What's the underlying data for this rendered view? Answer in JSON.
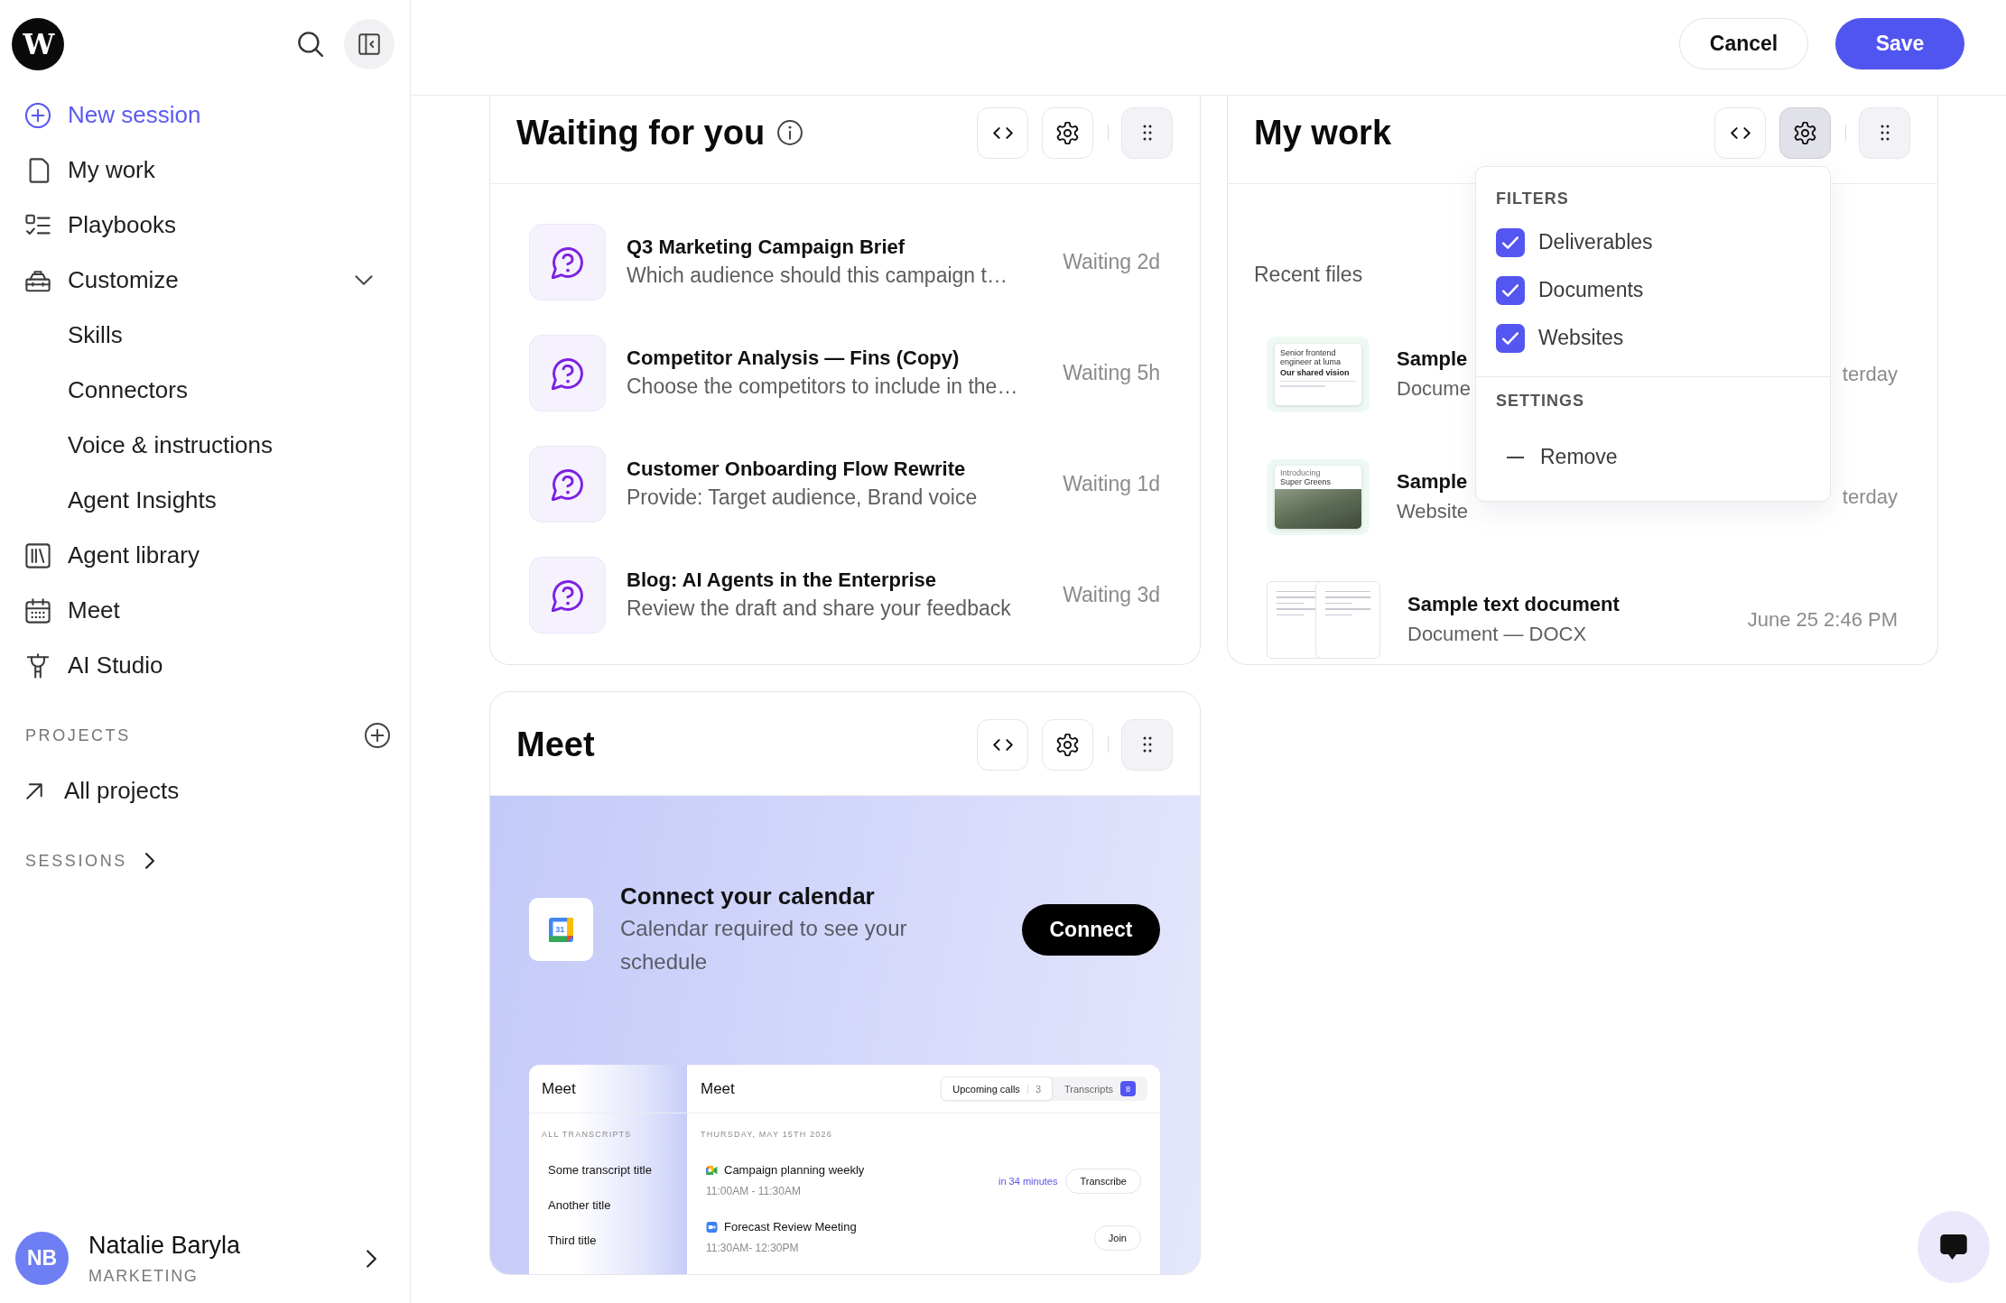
{
  "sidebar": {
    "logo": "W",
    "nav": [
      {
        "kind": "action",
        "label": "New session"
      },
      {
        "kind": "link",
        "label": "My work",
        "selected": false
      },
      {
        "kind": "link",
        "label": "Playbooks",
        "selected": false
      },
      {
        "kind": "group",
        "label": "Customize",
        "expanded": true,
        "children": [
          {
            "label": "Skills",
            "selected": false
          },
          {
            "label": "Connectors",
            "selected": false
          },
          {
            "label": "Voice & instructions",
            "selected": false
          },
          {
            "label": "Agent Insights",
            "selected": false
          }
        ]
      },
      {
        "kind": "link",
        "label": "Agent library",
        "selected": false
      },
      {
        "kind": "link",
        "label": "Meet",
        "selected": false
      },
      {
        "kind": "link",
        "label": "AI Studio",
        "selected": false
      }
    ],
    "projects": {
      "heading": "PROJECTS",
      "items": [
        {
          "label": "All projects",
          "selected": false
        }
      ]
    },
    "sessions": {
      "heading": "SESSIONS",
      "expanded": false
    },
    "user": {
      "initials": "NB",
      "name": "Natalie Baryla",
      "team": "MARKETING"
    }
  },
  "header": {
    "buttons": [
      {
        "kind": "secondary",
        "label": "Cancel"
      },
      {
        "kind": "primary",
        "label": "Save"
      }
    ]
  },
  "widgets": [
    {
      "kind": "waiting",
      "title": "Waiting for you",
      "info": true,
      "settings_open": false,
      "items": [
        {
          "title": "Q3 Marketing Campaign Brief",
          "subtitle": "Which audience should this campaign t…",
          "status": "Waiting 2d"
        },
        {
          "title": "Competitor Analysis — Fins (Copy)",
          "subtitle": "Choose the competitors to include in the…",
          "status": "Waiting 5h"
        },
        {
          "title": "Customer Onboarding Flow Rewrite",
          "subtitle": "Provide: Target audience, Brand voice",
          "status": "Waiting 1d"
        },
        {
          "title": "Blog: AI Agents in the Enterprise",
          "subtitle": "Review the draft and share your feedback",
          "status": "Waiting 3d"
        }
      ]
    },
    {
      "kind": "files",
      "title": "My work",
      "info": false,
      "settings_open": true,
      "section_label": "Recent files",
      "files": [
        {
          "kind": "document",
          "title": "Sample",
          "subtitle": "Docume",
          "date": "terday",
          "thumbnail": {
            "text": "Senior frontend engineer at luma",
            "heading": "Our shared vision"
          }
        },
        {
          "kind": "website",
          "title": "Sample",
          "subtitle": "Website",
          "date": "terday",
          "thumbnail": {
            "kicker": "Introducing",
            "heading": "Super Greens"
          }
        },
        {
          "kind": "text",
          "title": "Sample text document",
          "subtitle": "Document — DOCX",
          "date": "June 25 2:46 PM"
        }
      ],
      "menu": {
        "sections": [
          {
            "heading": "FILTERS",
            "options": [
              {
                "kind": "checkbox",
                "label": "Deliverables",
                "checked": true
              },
              {
                "kind": "checkbox",
                "label": "Documents",
                "checked": true
              },
              {
                "kind": "checkbox",
                "label": "Websites",
                "checked": true
              }
            ]
          },
          {
            "heading": "SETTINGS",
            "options": [
              {
                "kind": "action",
                "label": "Remove"
              }
            ]
          }
        ]
      }
    },
    {
      "kind": "meet",
      "title": "Meet",
      "info": false,
      "settings_open": false,
      "connect": {
        "calendar_day": "31",
        "title": "Connect your calendar",
        "text": "Calendar required to see your schedule",
        "button": "Connect"
      },
      "preview": {
        "sidebar_title": "Meet",
        "section": "ALL TRANSCRIPTS",
        "transcripts": [
          {
            "label": "Some transcript title"
          },
          {
            "label": "Another title"
          },
          {
            "label": "Third title"
          }
        ],
        "title": "Meet",
        "tabs": [
          {
            "kind": "plain",
            "label": "Upcoming calls",
            "count": "3",
            "selected": true
          },
          {
            "kind": "badge",
            "label": "Transcripts",
            "count": "8",
            "selected": false
          }
        ],
        "date": "THURSDAY, MAY 15TH 2026",
        "events": [
          {
            "title": "Campaign planning weekly",
            "time": "11:00AM - 11:30AM",
            "starts_in": "in 34 minutes",
            "action": "Transcribe"
          },
          {
            "title": "Forecast Review Meeting",
            "time": "11:30AM- 12:30PM",
            "action": "Join"
          }
        ]
      }
    }
  ]
}
